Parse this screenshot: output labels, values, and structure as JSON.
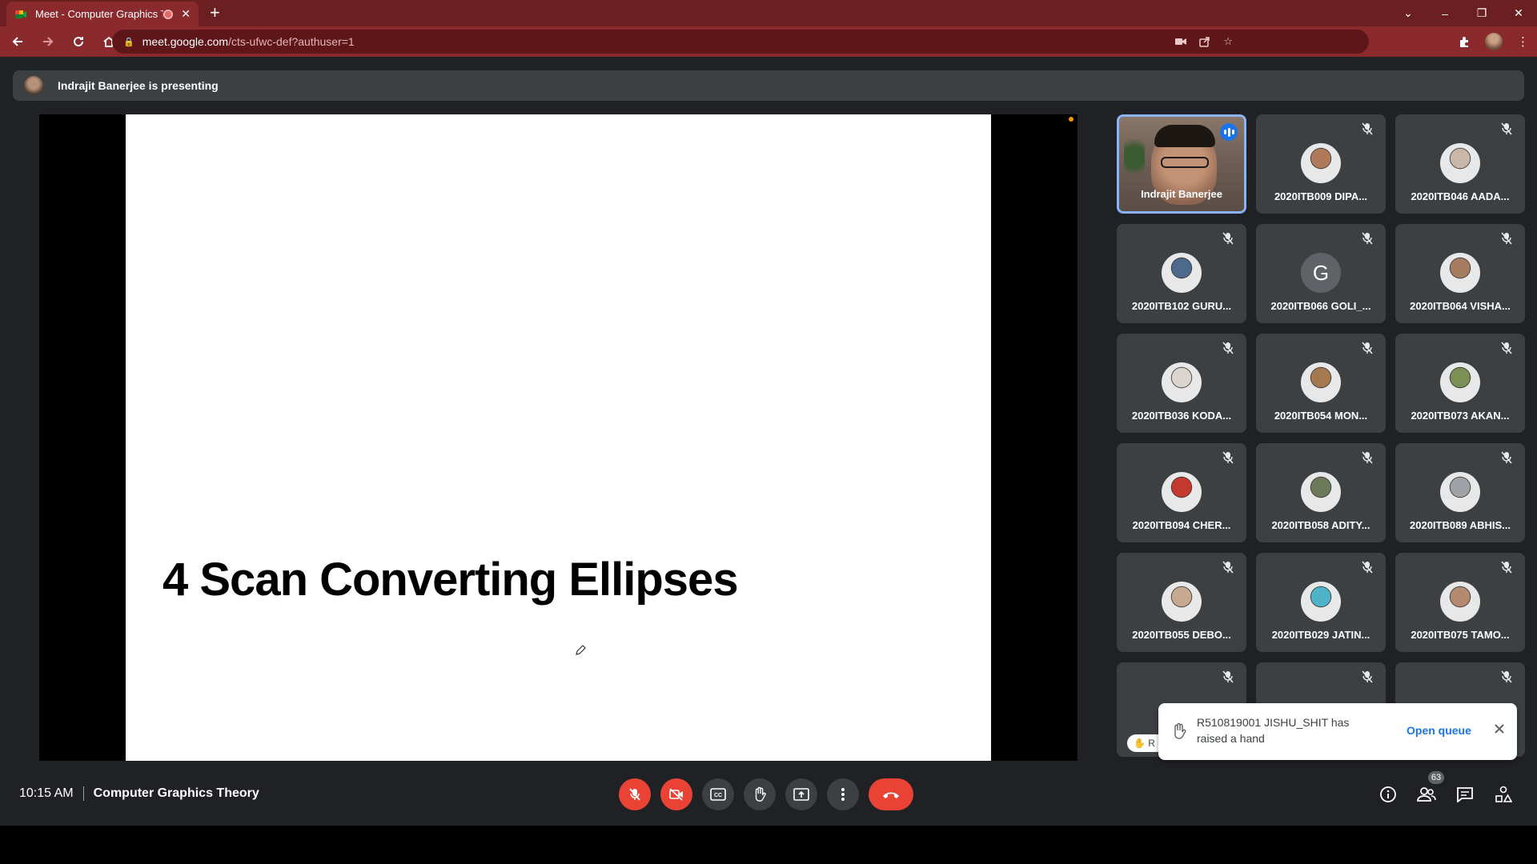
{
  "browser": {
    "tab_title": "Meet - Computer Graphics T",
    "url_host": "meet.google.com",
    "url_path": "/cts-ufwc-def?authuser=1"
  },
  "presenting_banner": "Indrajit Banerjee is presenting",
  "slide": {
    "title": "4 Scan Converting Ellipses"
  },
  "participants": [
    {
      "name": "Indrajit Banerjee",
      "speaking": true
    },
    {
      "name": "2020ITB009 DIPA...",
      "avatar_color": "#b07a5a"
    },
    {
      "name": "2020ITB046 AADA...",
      "avatar_color": "#c9b8aa"
    },
    {
      "name": "2020ITB102 GURU...",
      "avatar_color": "#4d6a8c"
    },
    {
      "name": "2020ITB066 GOLI_...",
      "avatar_letter": "G",
      "avatar_color": "#5f6368"
    },
    {
      "name": "2020ITB064 VISHA...",
      "avatar_color": "#a77d62"
    },
    {
      "name": "2020ITB036 KODA...",
      "avatar_color": "#d9d4cf"
    },
    {
      "name": "2020ITB054 MON...",
      "avatar_color": "#a5794f"
    },
    {
      "name": "2020ITB073 AKAN...",
      "avatar_color": "#7c8f55"
    },
    {
      "name": "2020ITB094 CHER...",
      "avatar_color": "#c43a2f"
    },
    {
      "name": "2020ITB058 ADITY...",
      "avatar_color": "#6c7a5a"
    },
    {
      "name": "2020ITB089 ABHIS...",
      "avatar_color": "#9fa3a8"
    },
    {
      "name": "2020ITB055 DEBO...",
      "avatar_color": "#c7a890"
    },
    {
      "name": "2020ITB029 JATIN...",
      "avatar_color": "#4fb3c8"
    },
    {
      "name": "2020ITB075 TAMO...",
      "avatar_color": "#b48b6e"
    }
  ],
  "toast": {
    "message": "R510819001 JISHU_SHIT has raised a hand",
    "action": "Open queue"
  },
  "raise_chip_text": "R",
  "bottom": {
    "time": "10:15 AM",
    "meeting_name": "Computer Graphics Theory",
    "people_count": "63"
  },
  "colors": {
    "browser_frame": "#8b2a2d",
    "meet_bg": "#202124",
    "tile_bg": "#3c4043",
    "danger": "#ea4335",
    "accent": "#1a73e8"
  }
}
